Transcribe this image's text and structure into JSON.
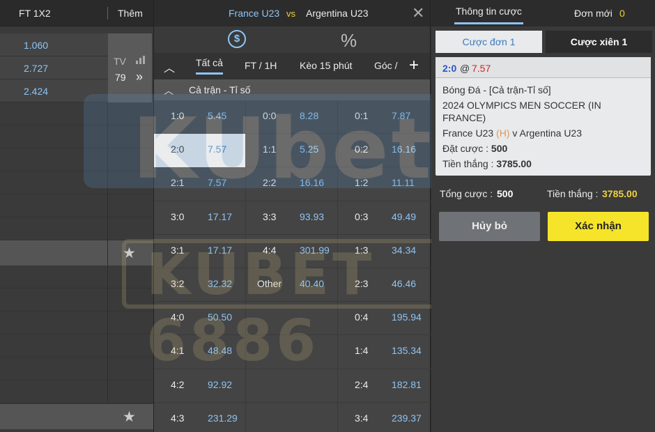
{
  "left": {
    "header_col1": "FT 1X2",
    "header_col2": "Thêm",
    "odds": [
      "1.060",
      "2.727",
      "2.424"
    ],
    "tv_label": "TV",
    "more_count": "79",
    "more_arrow": "»"
  },
  "match": {
    "home": "France U23",
    "vs": "vs",
    "away": "Argentina U23"
  },
  "market_tabs": [
    "Tất cả",
    "FT / 1H",
    "Kèo 15 phút",
    "Góc /"
  ],
  "section_label": "Cả trận - Tỉ số",
  "score_grid": [
    [
      {
        "s": "1:0",
        "o": "5.45"
      },
      {
        "s": "0:0",
        "o": "8.28"
      },
      {
        "s": "0:1",
        "o": "7.87"
      }
    ],
    [
      {
        "s": "2:0",
        "o": "7.57"
      },
      {
        "s": "1:1",
        "o": "5.25"
      },
      {
        "s": "0:2",
        "o": "16.16"
      }
    ],
    [
      {
        "s": "2:1",
        "o": "7.57"
      },
      {
        "s": "2:2",
        "o": "16.16"
      },
      {
        "s": "1:2",
        "o": "11.11"
      }
    ],
    [
      {
        "s": "3:0",
        "o": "17.17"
      },
      {
        "s": "3:3",
        "o": "93.93"
      },
      {
        "s": "0:3",
        "o": "49.49"
      }
    ],
    [
      {
        "s": "3:1",
        "o": "17.17"
      },
      {
        "s": "4:4",
        "o": "301.99"
      },
      {
        "s": "1:3",
        "o": "34.34"
      }
    ],
    [
      {
        "s": "3:2",
        "o": "32.32"
      },
      {
        "s": "Other",
        "o": "40.40"
      },
      {
        "s": "2:3",
        "o": "46.46"
      }
    ],
    [
      {
        "s": "4:0",
        "o": "50.50"
      },
      {
        "s": "",
        "o": ""
      },
      {
        "s": "0:4",
        "o": "195.94"
      }
    ],
    [
      {
        "s": "4:1",
        "o": "48.48"
      },
      {
        "s": "",
        "o": ""
      },
      {
        "s": "1:4",
        "o": "135.34"
      }
    ],
    [
      {
        "s": "4:2",
        "o": "92.92"
      },
      {
        "s": "",
        "o": ""
      },
      {
        "s": "2:4",
        "o": "182.81"
      }
    ],
    [
      {
        "s": "4:3",
        "o": "231.29"
      },
      {
        "s": "",
        "o": ""
      },
      {
        "s": "3:4",
        "o": "239.37"
      }
    ]
  ],
  "selected": {
    "row": 1,
    "col": 0
  },
  "slip": {
    "tab_info": "Thông tin cược",
    "tab_new": "Đơn mới",
    "new_count": "0",
    "tab_single": "Cược đơn 1",
    "tab_parlay": "Cược xiên 1",
    "score": "2:0",
    "at": "@",
    "odd": "7.57",
    "line1": "Bóng Đá - [Cả trận-Tỉ số]",
    "line2": "2024 OLYMPICS MEN SOCCER (IN FRANCE)",
    "home": "France U23",
    "home_tag": "(H)",
    "v_away": "v Argentina U23",
    "stake_label": "Đặt cược :",
    "stake_value": "500",
    "win_label": "Tiền thắng :",
    "win_value": "3785.00",
    "total_stake_label": "Tổng cược :",
    "total_stake_value": "500",
    "total_win_label": "Tiền thắng :",
    "total_win_value": "3785.00",
    "cancel": "Hủy bỏ",
    "confirm": "Xác nhận"
  },
  "watermark": {
    "line1": "KUbet",
    "line2": "KUBET 6886"
  },
  "colors": {
    "odds_blue": "#8ec5f5",
    "accent_yellow": "#f5e42a",
    "score_red": "#d4251e"
  }
}
